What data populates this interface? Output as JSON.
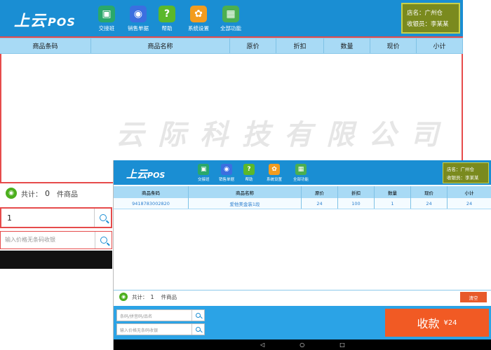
{
  "main": {
    "logo_text": "上云",
    "logo_pos": "POS",
    "nav": [
      {
        "label": "交接班",
        "color": "#2aa86a",
        "glyph": "▣",
        "icon": "shift-handover-icon"
      },
      {
        "label": "销售单据",
        "color": "#3b6fe0",
        "glyph": "◉",
        "icon": "sales-receipt-icon"
      },
      {
        "label": "帮助",
        "color": "#5bb82a",
        "glyph": "?",
        "icon": "help-icon"
      },
      {
        "label": "系统设置",
        "color": "#f39c1e",
        "glyph": "✿",
        "icon": "settings-icon"
      },
      {
        "label": "全部功能",
        "color": "#4caf50",
        "glyph": "▦",
        "icon": "all-functions-icon"
      }
    ],
    "store": "店名：广州仓",
    "cashier": "收银员：李某某",
    "columns": [
      "商品条码",
      "商品名称",
      "原价",
      "折扣",
      "数量",
      "现价",
      "小计"
    ],
    "watermark": "云际科技有限公司",
    "count_prefix": "共计：",
    "count_value": "0",
    "count_suffix": "件商品",
    "barcode_value": "1",
    "price_placeholder": "输入价格无条码收银"
  },
  "overlay": {
    "logo_text": "上云",
    "logo_pos": "POS",
    "nav": [
      {
        "label": "交接班",
        "color": "#2aa86a",
        "glyph": "▣",
        "icon": "shift-handover-icon"
      },
      {
        "label": "销售单据",
        "color": "#3b6fe0",
        "glyph": "◉",
        "icon": "sales-receipt-icon"
      },
      {
        "label": "帮助",
        "color": "#5bb82a",
        "glyph": "?",
        "icon": "help-icon"
      },
      {
        "label": "系统设置",
        "color": "#f39c1e",
        "glyph": "✿",
        "icon": "settings-icon"
      },
      {
        "label": "全部功能",
        "color": "#4caf50",
        "glyph": "▦",
        "icon": "all-functions-icon"
      }
    ],
    "store": "店名：广州仓",
    "cashier": "收银员：李某某",
    "columns": [
      "商品条码",
      "商品名称",
      "原价",
      "折扣",
      "数量",
      "现价",
      "小计"
    ],
    "rows": [
      [
        "9418783002820",
        "爱他美金装1段",
        "24",
        "100",
        "1",
        "24",
        "24"
      ]
    ],
    "count_prefix": "共计：",
    "count_value": "1",
    "count_suffix": "件商品",
    "clear_label": "清空",
    "barcode_placeholder": "条码/拼音码/品名",
    "price_placeholder": "输入价格无条码收银",
    "pay_label": "收款",
    "pay_amount": "¥24",
    "android_nav": [
      "◁",
      "○",
      "□"
    ]
  }
}
